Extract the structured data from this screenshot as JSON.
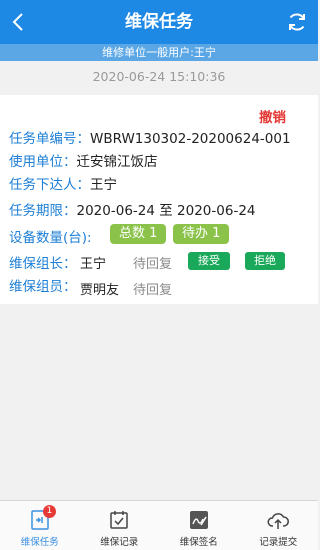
{
  "header": {
    "title": "维保任务",
    "back_icon": "chevron-left-icon",
    "refresh_icon": "refresh-icon",
    "color": "#1e88e5"
  },
  "subheader": {
    "text": "维修单位一般用户:王宁"
  },
  "timestamp": "2020-06-24 15:10:36",
  "task": {
    "cancel_label": "撤销",
    "number_label": "任务单编号：",
    "number_value": "WBRW130302-20200624-001",
    "unit_label": "使用单位：",
    "unit_value": "迁安锦江饭店",
    "issuer_label": "任务下达人：",
    "issuer_value": "王宁",
    "period_label": "任务期限：",
    "period_value": "2020-06-24 至 2020-06-24",
    "equipment_label": "设备数量(台):",
    "total_pill": "总数 1",
    "pending_pill": "待办 1",
    "leader_label": "维保组长：",
    "leader_name": "王宁",
    "leader_status": "待回复",
    "accept_label": "接受",
    "reject_label": "拒绝",
    "members_label": "维保组员：",
    "member_name": "贾明友",
    "member_status": "待回复"
  },
  "tabs": [
    {
      "label": "维保任务",
      "icon": "task-inbox-icon",
      "badge": "1",
      "active": true
    },
    {
      "label": "维保记录",
      "icon": "calendar-check-icon",
      "active": false
    },
    {
      "label": "维保签名",
      "icon": "signature-icon",
      "active": false
    },
    {
      "label": "记录提交",
      "icon": "cloud-upload-icon",
      "active": false
    }
  ]
}
